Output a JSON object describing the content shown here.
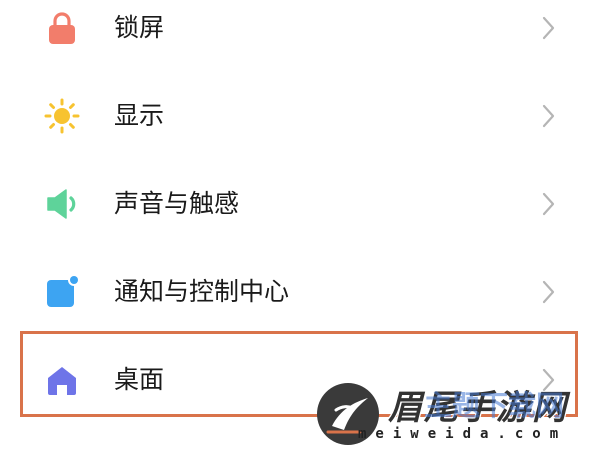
{
  "settings": {
    "items": [
      {
        "label": "锁屏",
        "icon": "lock-icon",
        "color": "#F27D6B"
      },
      {
        "label": "显示",
        "icon": "sun-icon",
        "color": "#F7C330"
      },
      {
        "label": "声音与触感",
        "icon": "speaker-icon",
        "color": "#5ED39A"
      },
      {
        "label": "通知与控制中心",
        "icon": "notification-icon",
        "color": "#3DA4F2"
      },
      {
        "label": "桌面",
        "icon": "home-icon",
        "color": "#6E74E8",
        "highlighted": true
      }
    ],
    "chevron_icon": "chevron-right-icon",
    "highlight_color": "#D9734A"
  },
  "watermark": {
    "title": "眉尾手游网",
    "overlay": "主题下载网",
    "subtitle": "meiweida.com"
  }
}
